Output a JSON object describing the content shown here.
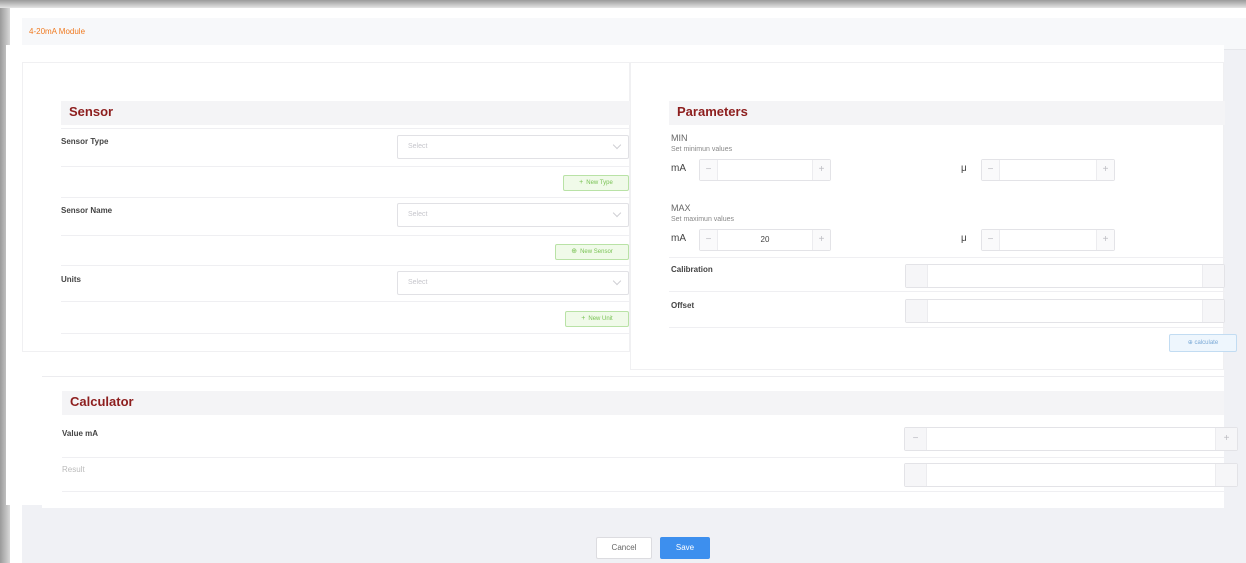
{
  "window": {
    "title": "4-20mA Module"
  },
  "sensor": {
    "title": "Sensor",
    "sensor_type": {
      "label": "Sensor Type",
      "placeholder": "Select",
      "add_label": "New Type"
    },
    "sensor_name": {
      "label": "Sensor Name",
      "placeholder": "Select",
      "add_label": "New Sensor"
    },
    "units": {
      "label": "Units",
      "placeholder": "Select",
      "add_label": "New Unit"
    }
  },
  "parameters": {
    "title": "Parameters",
    "min": {
      "label": "MIN",
      "hint": "Set minimun values",
      "unit_ma": "mA",
      "value_ma": "",
      "unit_mu": "μ",
      "value_mu": ""
    },
    "max": {
      "label": "MAX",
      "hint": "Set maximun values",
      "unit_ma": "mA",
      "value_ma": "20",
      "unit_mu": "μ",
      "value_mu": ""
    },
    "calibration": {
      "label": "Calibration",
      "value": ""
    },
    "offset": {
      "label": "Offset",
      "value": ""
    },
    "calculate_label": "calculate"
  },
  "calculator": {
    "title": "Calculator",
    "value_ma": {
      "label": "Value mA",
      "value": ""
    },
    "result": {
      "label": "Result",
      "value": ""
    }
  },
  "footer": {
    "cancel_label": "Cancel",
    "save_label": "Save"
  },
  "colors": {
    "title_accent": "#f07b22",
    "section_title": "#8d1e1e",
    "primary": "#3d8fee",
    "success": "#79c254"
  }
}
